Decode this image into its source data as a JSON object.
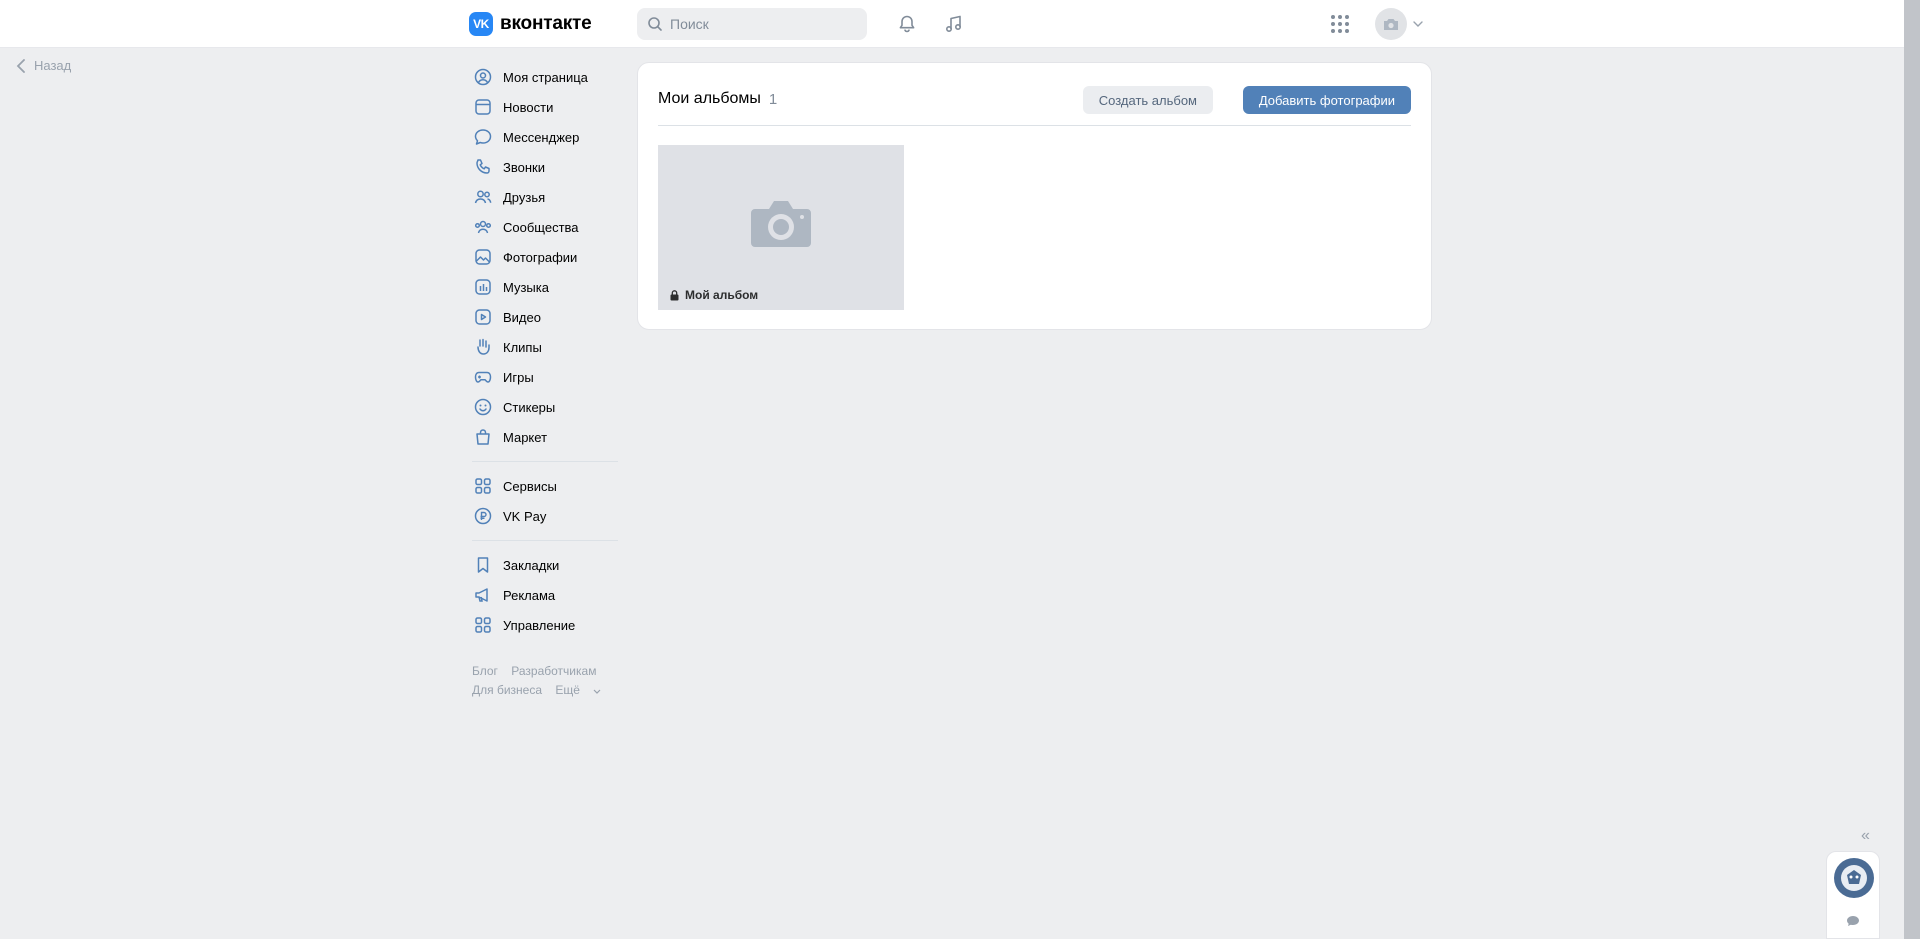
{
  "header": {
    "logo_mark": "VK",
    "logo_text": "вконтакте",
    "search_placeholder": "Поиск",
    "icons": [
      "bell-icon",
      "music-icon",
      "apps-grid-icon",
      "camera-icon",
      "chevron-down-icon"
    ]
  },
  "back": {
    "label": "Назад"
  },
  "sidebar": {
    "groups": [
      [
        {
          "label": "Моя страница",
          "icon": "user-circle-icon"
        },
        {
          "label": "Новости",
          "icon": "news-icon"
        },
        {
          "label": "Мессенджер",
          "icon": "message-icon"
        },
        {
          "label": "Звонки",
          "icon": "phone-icon"
        },
        {
          "label": "Друзья",
          "icon": "friends-icon"
        },
        {
          "label": "Сообщества",
          "icon": "communities-icon"
        },
        {
          "label": "Фотографии",
          "icon": "photo-icon"
        },
        {
          "label": "Музыка",
          "icon": "music-square-icon"
        },
        {
          "label": "Видео",
          "icon": "video-icon"
        },
        {
          "label": "Клипы",
          "icon": "clips-icon"
        },
        {
          "label": "Игры",
          "icon": "gamepad-icon"
        },
        {
          "label": "Стикеры",
          "icon": "smile-icon"
        },
        {
          "label": "Маркет",
          "icon": "bag-icon"
        }
      ],
      [
        {
          "label": "Сервисы",
          "icon": "services-icon"
        },
        {
          "label": "VK Pay",
          "icon": "vkpay-icon"
        }
      ],
      [
        {
          "label": "Закладки",
          "icon": "bookmark-icon"
        },
        {
          "label": "Реклама",
          "icon": "megaphone-icon"
        },
        {
          "label": "Управление",
          "icon": "manage-icon"
        }
      ]
    ],
    "footer": {
      "blog": "Блог",
      "developers": "Разработчикам",
      "business": "Для бизнеса",
      "more": "Ещё"
    }
  },
  "main": {
    "title": "Мои альбомы",
    "count": "1",
    "create_album": "Создать альбом",
    "add_photos": "Добавить фотографии",
    "albums": [
      {
        "name": "Мой альбом",
        "private": true
      }
    ]
  },
  "widget": {
    "collapse": "«"
  },
  "colors": {
    "accent": "#5181b8",
    "logo": "#2787f5",
    "background": "#edeef0"
  }
}
